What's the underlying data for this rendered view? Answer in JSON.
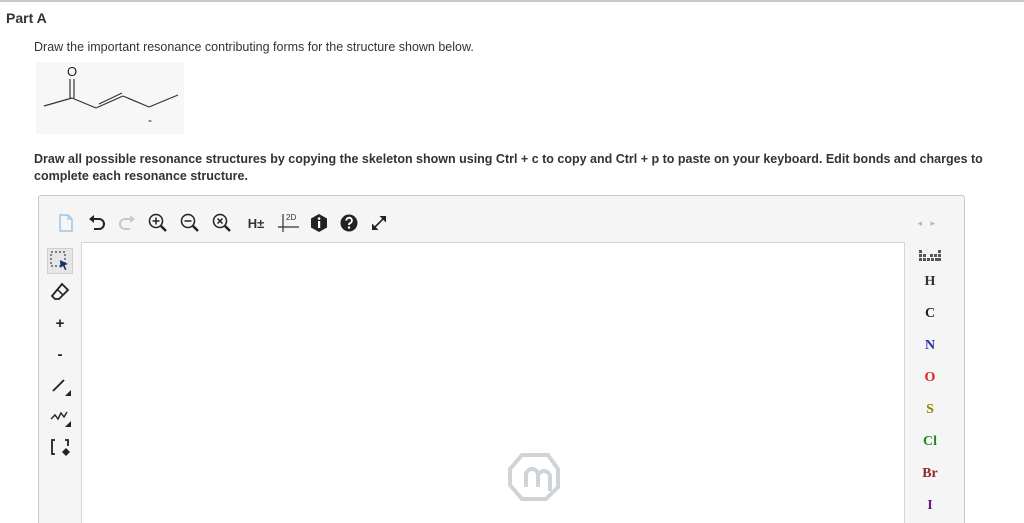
{
  "part": {
    "title": "Part A"
  },
  "question": {
    "prompt": "Draw the important resonance contributing forms for the structure shown below.",
    "task": "Draw all possible resonance structures by copying the skeleton shown using Ctrl + c to copy and Ctrl + p to paste on your keyboard. Edit bonds and charges to complete each resonance structure."
  },
  "molecule": {
    "oxygen_label": "O",
    "charge_label": "-"
  },
  "editor": {
    "toolbar": {
      "icons": [
        "new-document-icon",
        "undo-icon",
        "redo-icon",
        "zoom-in-icon",
        "zoom-out-icon",
        "zoom-reset-icon",
        "explicit-hydrogens-icon",
        "clean-2d-icon",
        "info-icon",
        "help-icon",
        "fullscreen-icon"
      ],
      "hydrogens_label": "H±",
      "clean_label": "2D",
      "nav_arrows": "◂ ▸"
    },
    "left_tools": {
      "icons": [
        "selection-tool-icon",
        "eraser-icon",
        "single-bond-icon",
        "chain-icon",
        "bracket-icon"
      ],
      "plus_label": "+",
      "minus_label": "-"
    },
    "elements": [
      {
        "symbol": "H",
        "color": "#333333"
      },
      {
        "symbol": "C",
        "color": "#222222"
      },
      {
        "symbol": "N",
        "color": "#2a2ab0"
      },
      {
        "symbol": "O",
        "color": "#e02020"
      },
      {
        "symbol": "S",
        "color": "#8a8a00"
      },
      {
        "symbol": "Cl",
        "color": "#1e8a1e"
      },
      {
        "symbol": "Br",
        "color": "#8a2a2a"
      },
      {
        "symbol": "I",
        "color": "#6a1a8a"
      }
    ]
  }
}
